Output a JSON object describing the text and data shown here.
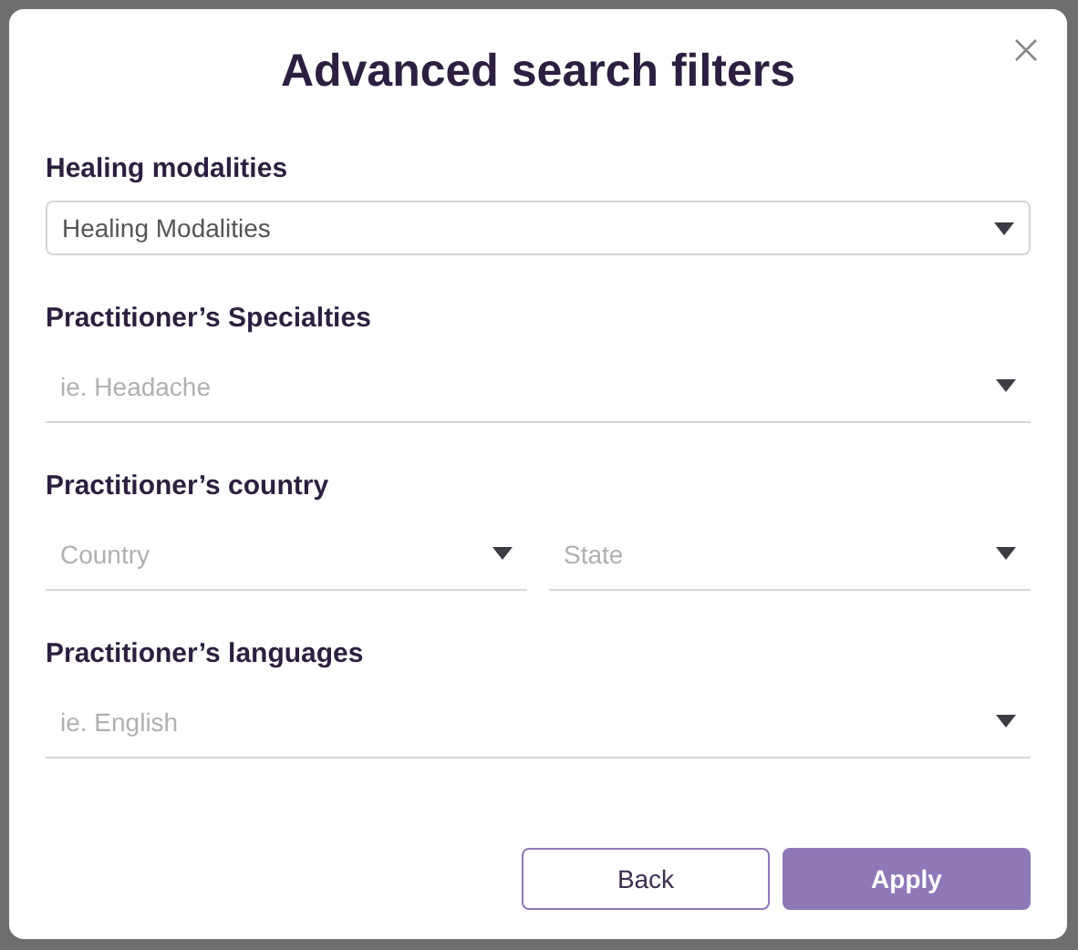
{
  "dialog": {
    "title": "Advanced search filters"
  },
  "sections": [
    {
      "label": "Healing modalities",
      "fields": [
        {
          "kind": "boxed",
          "value": "Healing Modalities"
        }
      ]
    },
    {
      "label": "Practitioner’s Specialties",
      "fields": [
        {
          "kind": "underline",
          "placeholder": "ie. Headache"
        }
      ]
    },
    {
      "label": "Practitioner’s country",
      "fields": [
        {
          "kind": "underline",
          "placeholder": "Country"
        },
        {
          "kind": "underline",
          "placeholder": "State"
        }
      ]
    },
    {
      "label": "Practitioner’s languages",
      "fields": [
        {
          "kind": "underline",
          "placeholder": "ie. English"
        }
      ]
    }
  ],
  "buttons": [
    {
      "label": "Back",
      "kind": "secondary"
    },
    {
      "label": "Apply",
      "kind": "primary"
    }
  ]
}
